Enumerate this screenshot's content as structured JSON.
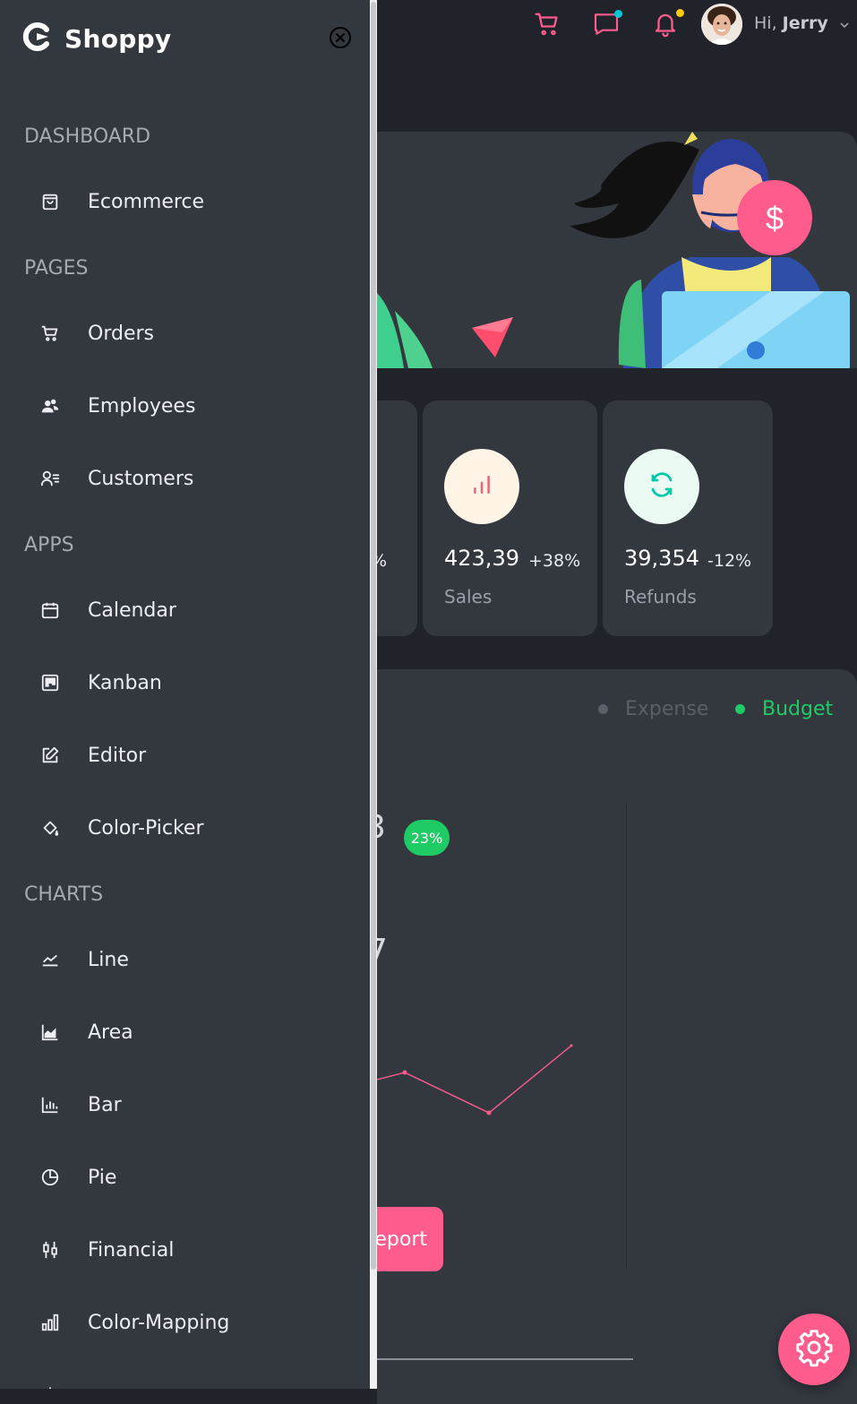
{
  "app": {
    "name": "Shoppy"
  },
  "header": {
    "greeting": "Hi,",
    "user_name": "Jerry",
    "colors": {
      "icon": "#ff5c8e",
      "chat_dot": "#03c9d7",
      "bell_dot": "#fec90f"
    }
  },
  "sidebar": {
    "sections": [
      {
        "title": "DASHBOARD",
        "items": [
          {
            "label": "Ecommerce",
            "icon": "shopping-bag-icon"
          }
        ]
      },
      {
        "title": "PAGES",
        "items": [
          {
            "label": "Orders",
            "icon": "cart-icon"
          },
          {
            "label": "Employees",
            "icon": "employees-icon"
          },
          {
            "label": "Customers",
            "icon": "customers-icon"
          }
        ]
      },
      {
        "title": "APPS",
        "items": [
          {
            "label": "Calendar",
            "icon": "calendar-icon"
          },
          {
            "label": "Kanban",
            "icon": "kanban-icon"
          },
          {
            "label": "Editor",
            "icon": "edit-icon"
          },
          {
            "label": "Color-Picker",
            "icon": "paint-bucket-icon"
          }
        ]
      },
      {
        "title": "CHARTS",
        "items": [
          {
            "label": "Line",
            "icon": "line-chart-icon"
          },
          {
            "label": "Area",
            "icon": "area-chart-icon"
          },
          {
            "label": "Bar",
            "icon": "bar-chart-icon"
          },
          {
            "label": "Pie",
            "icon": "pie-chart-icon"
          },
          {
            "label": "Financial",
            "icon": "candlestick-icon"
          },
          {
            "label": "Color-Mapping",
            "icon": "color-mapping-icon"
          }
        ]
      }
    ]
  },
  "stats": [
    {
      "value": "423,39",
      "percent": "+38%",
      "label": "Sales",
      "icon": "bar-chart-icon",
      "icon_color": "#e46a76",
      "icon_bg": "#fff4e5",
      "pct_color": "#e8eaed"
    },
    {
      "value": "39,354",
      "percent": "-12%",
      "label": "Refunds",
      "icon": "refresh-icon",
      "icon_color": "#03c9a9",
      "icon_bg": "#ebfaf2",
      "pct_color": "#e8eaed"
    }
  ],
  "partial_stat_percent": "%",
  "revenue": {
    "legend": [
      {
        "label": "Expense",
        "color": "#5a5f69"
      },
      {
        "label": "Budget",
        "color": "#1fcb64"
      }
    ],
    "badge": "23%",
    "report_button": "eport",
    "sparkline_color": "#ff5c8e"
  },
  "hero": {
    "dollar": "$"
  }
}
